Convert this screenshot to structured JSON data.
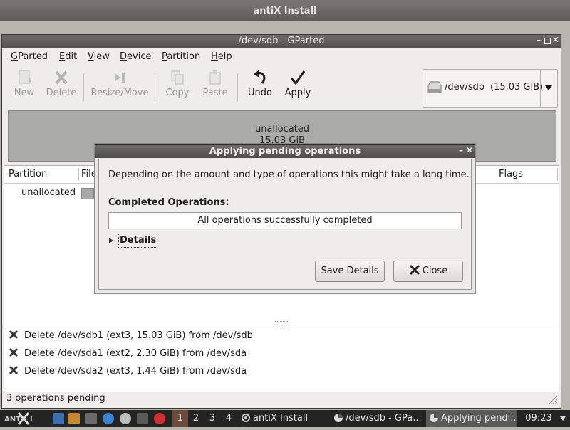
{
  "outer_window": {
    "title": "antiX Install"
  },
  "gparted": {
    "title": "/dev/sdb - GParted",
    "menu": [
      {
        "label": "GParted",
        "key": "G",
        "rest": "Parted"
      },
      {
        "label": "Edit",
        "key": "E",
        "rest": "dit"
      },
      {
        "label": "View",
        "key": "V",
        "rest": "iew"
      },
      {
        "label": "Device",
        "key": "D",
        "rest": "evice"
      },
      {
        "label": "Partition",
        "key": "P",
        "rest": "artition"
      },
      {
        "label": "Help",
        "key": "H",
        "rest": "elp"
      }
    ],
    "toolbar": {
      "new": "New",
      "delete": "Delete",
      "resize": "Resize/Move",
      "copy": "Copy",
      "paste": "Paste",
      "undo": "Undo",
      "apply": "Apply"
    },
    "device": {
      "path": "/dev/sdb",
      "size": "(15.03 GiB)"
    },
    "graph": {
      "line1": "unallocated",
      "line2": "15.03 GiB"
    },
    "columns": {
      "partition": "Partition",
      "filesystem": "File",
      "flags": "Flags"
    },
    "rows": [
      {
        "partition": "unallocated",
        "filesystem_prefix": "u"
      }
    ],
    "operations": [
      "Delete /dev/sdb1 (ext3, 15.03 GiB) from /dev/sdb",
      "Delete /dev/sda1 (ext2, 2.30 GiB) from /dev/sda",
      "Delete /dev/sda2 (ext3, 1.44 GiB) from /dev/sda"
    ],
    "status": "3 operations pending"
  },
  "dialog": {
    "title": "Applying pending operations",
    "message": "Depending on the amount and type of operations this might take a long time.",
    "completed_label": "Completed Operations:",
    "progress_text": "All operations successfully completed",
    "progress_fraction": 1.0,
    "details_label": "Details",
    "save_details": "Save Details",
    "close": "Close"
  },
  "taskbar": {
    "workspaces": [
      "1",
      "2",
      "3",
      "4"
    ],
    "active_workspace": "1",
    "tasks": [
      "antiX Install",
      "/dev/sdb - GPa...",
      "Applying pendi..."
    ],
    "clock": "09:23",
    "colors": {
      "active_ws": "#6b4a3a",
      "active_task": "#5a5a5a"
    }
  }
}
